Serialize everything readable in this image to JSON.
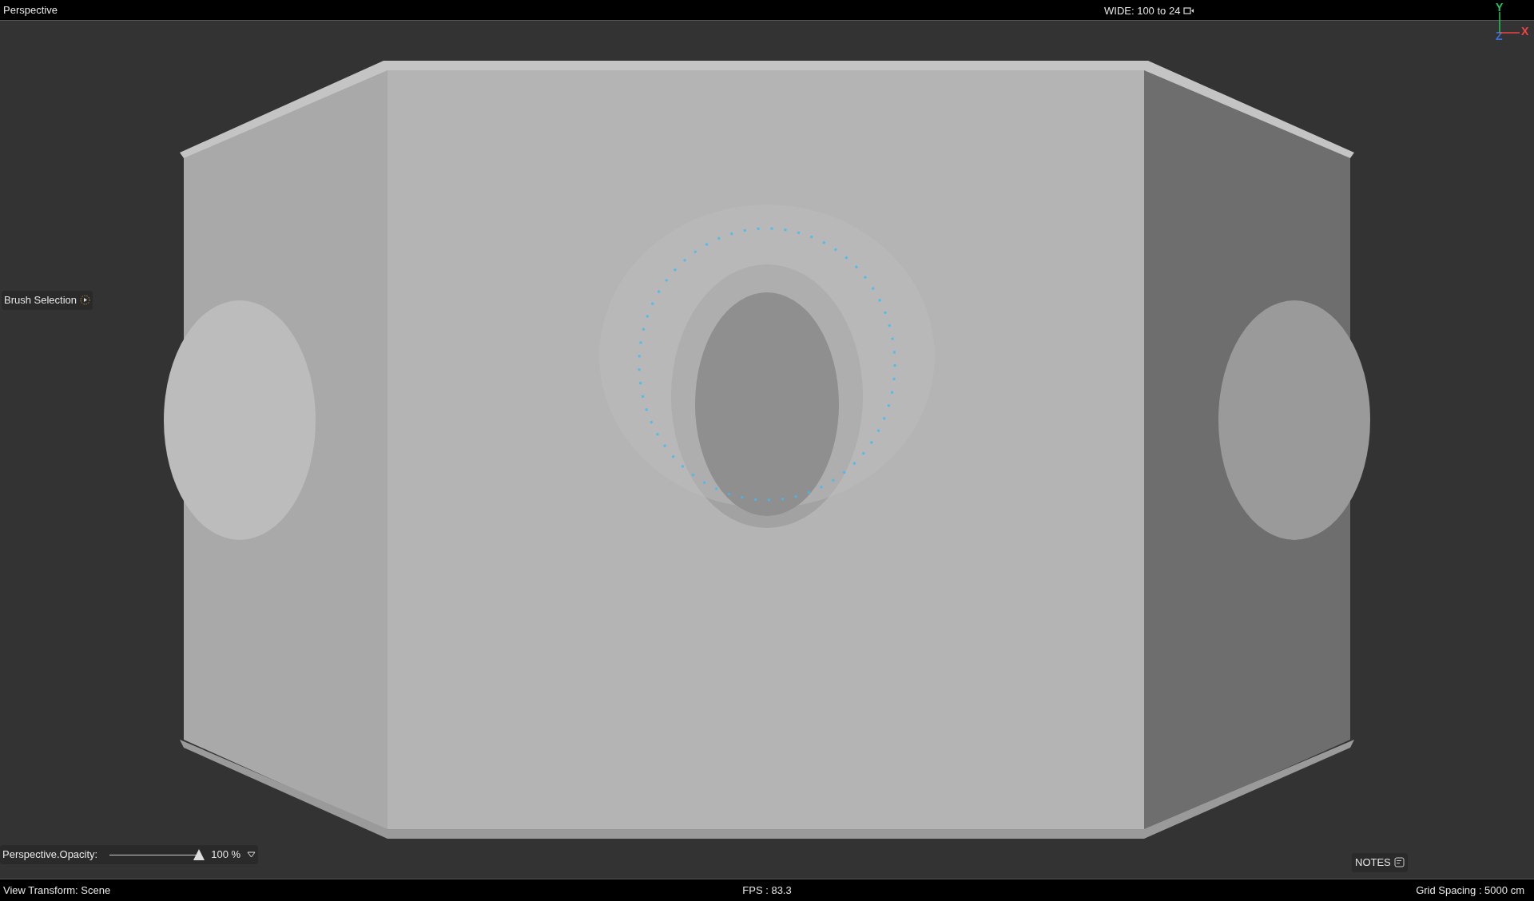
{
  "top_bar": {
    "view_name": "Perspective",
    "camera": "WIDE: 100 to 24"
  },
  "axis_gizmo": {
    "labels": [
      {
        "text": "Y",
        "color": "#22c55e"
      },
      {
        "text": "X",
        "color": "#ef4444"
      },
      {
        "text": "Z",
        "color": "#3b6fd6"
      }
    ]
  },
  "brush_selection": {
    "label": "Brush Selection"
  },
  "opacity_control": {
    "label": "Perspective.Opacity:",
    "level": 1.0,
    "reading": "100 %"
  },
  "notes_button": {
    "label": "NOTES"
  },
  "status_bar": {
    "view_transform": "View Transform: Scene",
    "fps": "FPS : 83.3",
    "grid_spacing": "Grid Spacing : 5000 cm"
  }
}
